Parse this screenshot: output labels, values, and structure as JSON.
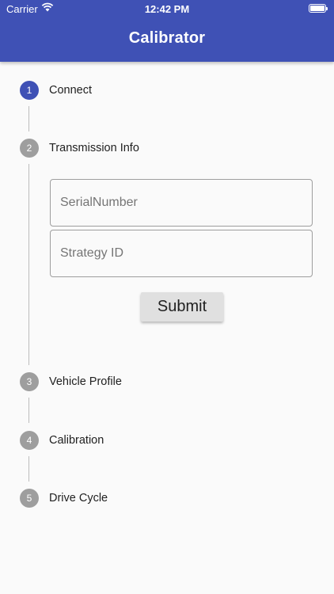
{
  "status_bar": {
    "carrier": "Carrier",
    "time": "12:42 PM"
  },
  "app_bar": {
    "title": "Calibrator"
  },
  "steps": [
    {
      "number": "1",
      "label": "Connect",
      "state": "active"
    },
    {
      "number": "2",
      "label": "Transmission Info",
      "state": "inactive"
    },
    {
      "number": "3",
      "label": "Vehicle Profile",
      "state": "inactive"
    },
    {
      "number": "4",
      "label": "Calibration",
      "state": "inactive"
    },
    {
      "number": "5",
      "label": "Drive Cycle",
      "state": "inactive"
    }
  ],
  "form": {
    "serial_placeholder": "SerialNumber",
    "serial_value": "",
    "strategy_placeholder": "Strategy ID",
    "strategy_value": "",
    "submit_label": "Submit"
  },
  "colors": {
    "primary": "#3f51b5",
    "inactive_step": "#9e9e9e",
    "background": "#fafafa"
  }
}
